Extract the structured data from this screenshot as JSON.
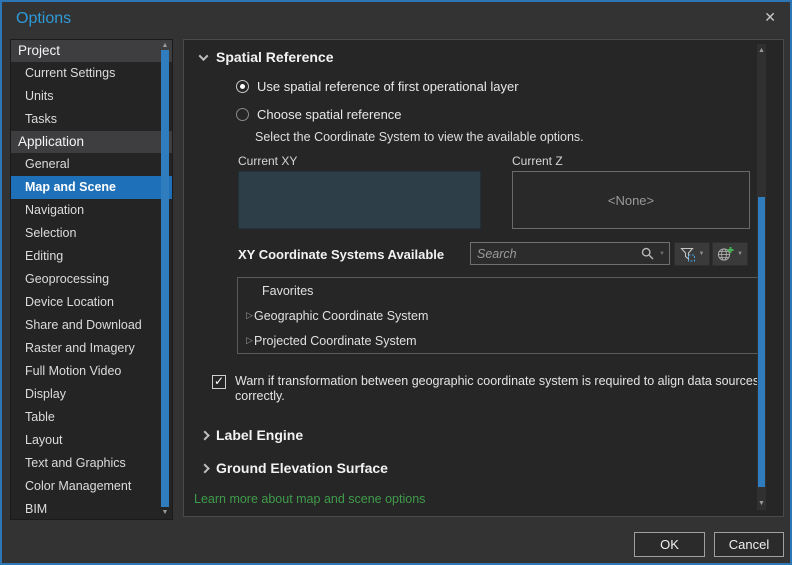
{
  "window": {
    "title": "Options",
    "close": "✕"
  },
  "icons": {
    "scroll_up": "▲",
    "scroll_down": "▼",
    "expand_right": "▷",
    "check": "✓",
    "caret": "▼"
  },
  "sidebar": {
    "selected_item": "Map and Scene",
    "sections": [
      {
        "header": "Project",
        "items": [
          "Current Settings",
          "Units",
          "Tasks"
        ]
      },
      {
        "header": "Application",
        "items": [
          "General",
          "Map and Scene",
          "Navigation",
          "Selection",
          "Editing",
          "Geoprocessing",
          "Device Location",
          "Share and Download",
          "Raster and Imagery",
          "Full Motion Video",
          "Display",
          "Table",
          "Layout",
          "Text and Graphics",
          "Color Management",
          "BIM"
        ]
      }
    ]
  },
  "panel": {
    "spatial_reference": {
      "title": "Spatial Reference",
      "radio_first_layer": "Use spatial reference of first operational layer",
      "radio_choose": "Choose spatial reference",
      "hint": "Select the Coordinate System to view the available options.",
      "current_xy_label": "Current XY",
      "current_z_label": "Current Z",
      "current_z_value": "<None>",
      "xy_systems_label": "XY Coordinate Systems Available",
      "search_placeholder": "Search",
      "list": [
        "Favorites",
        "Geographic Coordinate System",
        "Projected Coordinate System"
      ],
      "warn_checkbox": "Warn if transformation between geographic coordinate system is required to align data sources correctly."
    },
    "label_engine_title": "Label Engine",
    "ground_elevation_title": "Ground Elevation Surface",
    "learn_more": "Learn more about map and scene options"
  },
  "footer": {
    "ok": "OK",
    "cancel": "Cancel"
  }
}
